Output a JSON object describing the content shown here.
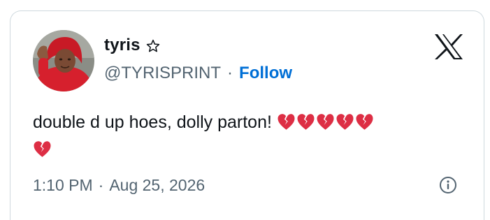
{
  "author": {
    "display_name": "tyris",
    "handle": "@TYRISPRINT",
    "badge_icon": "star-outline-icon",
    "follow_label": "Follow",
    "separator": "·"
  },
  "brand": {
    "logo_icon": "x-logo-icon"
  },
  "tweet": {
    "text": "double d up hoes, dolly parton!",
    "emoji": [
      "broken-heart",
      "broken-heart",
      "broken-heart",
      "broken-heart",
      "broken-heart",
      "broken-heart"
    ],
    "emoji_color": "#dd2e44"
  },
  "meta": {
    "time": "1:10 PM",
    "separator": "·",
    "date": "Aug 25, 2026",
    "info_icon": "info-icon"
  },
  "colors": {
    "link": "#006fd6",
    "secondary_text": "#536471",
    "primary_text": "#0f1419",
    "border": "#cfd9de"
  }
}
